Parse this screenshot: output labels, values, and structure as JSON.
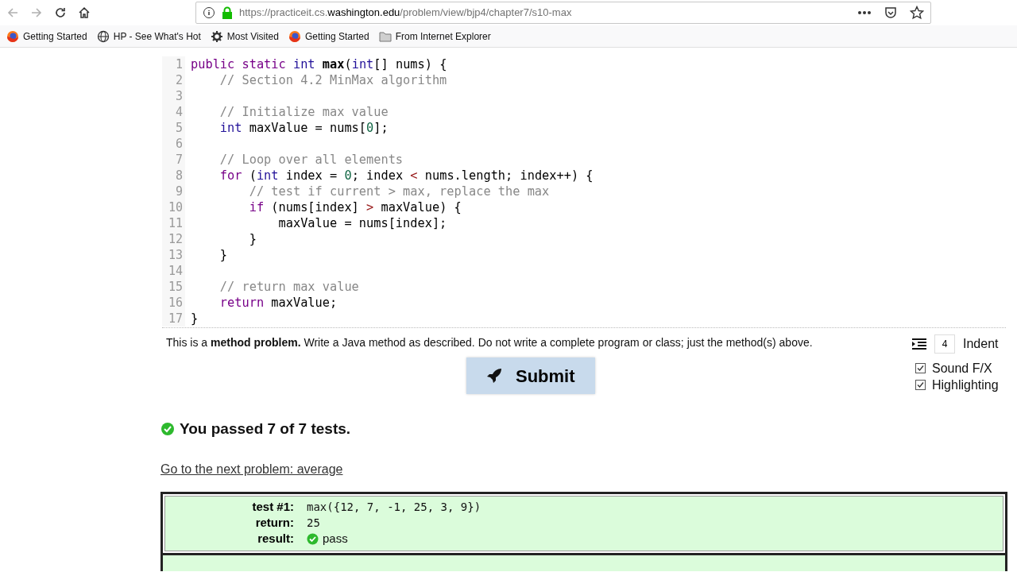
{
  "browser": {
    "url_host_prefix": "https://practiceit.cs.",
    "url_host": "washington.edu",
    "url_path": "/problem/view/bjp4/chapter7/s10-max",
    "bookmarks": [
      {
        "kind": "firefox",
        "label": "Getting Started"
      },
      {
        "kind": "globe",
        "label": "HP - See What's Hot"
      },
      {
        "kind": "gear",
        "label": "Most Visited"
      },
      {
        "kind": "firefox",
        "label": "Getting Started"
      },
      {
        "kind": "folder",
        "label": "From Internet Explorer"
      }
    ]
  },
  "editor": {
    "lines": [
      {
        "number": "1",
        "tokens": [
          {
            "kind": "keyword",
            "text": "public static"
          },
          {
            "kind": "type",
            "text": "int"
          },
          {
            "kind": "name",
            "text": "max"
          },
          {
            "kind": "plain",
            "text": "("
          },
          {
            "kind": "type",
            "text": "int"
          },
          {
            "kind": "plain",
            "text": "[] nums) {"
          }
        ]
      },
      {
        "number": "2",
        "tokens": [
          {
            "kind": "comment",
            "text": "    // Section 4.2 MinMax algorithm"
          }
        ]
      },
      {
        "number": "3"
      },
      {
        "number": "4",
        "tokens": [
          {
            "kind": "comment",
            "text": "    // Initialize max value"
          }
        ]
      },
      {
        "number": "5",
        "tokens": [
          {
            "kind": "type",
            "text": "    int"
          },
          {
            "kind": "plain",
            "text": " maxValue = nums["
          },
          {
            "kind": "number",
            "text": "0"
          },
          {
            "kind": "plain",
            "text": "];"
          }
        ]
      },
      {
        "number": "6"
      },
      {
        "number": "7",
        "tokens": [
          {
            "kind": "comment",
            "text": "    // Loop over all elements"
          }
        ]
      },
      {
        "number": "8",
        "tokens": [
          {
            "kind": "keyword",
            "text": "    for"
          },
          {
            "kind": "plain",
            "text": " ("
          },
          {
            "kind": "type",
            "text": "int"
          },
          {
            "kind": "plain",
            "text": " index = "
          },
          {
            "kind": "number",
            "text": "0"
          },
          {
            "kind": "plain",
            "text": "; index "
          },
          {
            "kind": "operator",
            "text": "<"
          },
          {
            "kind": "plain",
            "text": " nums.length; index++) {"
          }
        ]
      },
      {
        "number": "9",
        "tokens": [
          {
            "kind": "comment",
            "text": "        // test if current > max, replace the max"
          }
        ]
      },
      {
        "number": "10",
        "tokens": [
          {
            "kind": "keyword",
            "text": "        if"
          },
          {
            "kind": "plain",
            "text": " (nums[index] "
          },
          {
            "kind": "operator",
            "text": ">"
          },
          {
            "kind": "plain",
            "text": " maxValue) {"
          }
        ]
      },
      {
        "number": "11",
        "tokens": [
          {
            "kind": "plain",
            "text": "            maxValue = nums[index];"
          }
        ]
      },
      {
        "number": "12",
        "tokens": [
          {
            "kind": "plain",
            "text": "        }"
          }
        ]
      },
      {
        "number": "13",
        "tokens": [
          {
            "kind": "plain",
            "text": "    }"
          }
        ]
      },
      {
        "number": "14"
      },
      {
        "number": "15",
        "tokens": [
          {
            "kind": "comment",
            "text": "    // return max value"
          }
        ]
      },
      {
        "number": "16",
        "tokens": [
          {
            "kind": "keyword",
            "text": "    return"
          },
          {
            "kind": "plain",
            "text": " maxValue;"
          }
        ]
      },
      {
        "number": "17",
        "tokens": [
          {
            "kind": "plain",
            "text": "}"
          }
        ]
      }
    ]
  },
  "instructions": "This is a **method problem.** Write a Java method as described. Do not write a complete program or class; just the method(s) above.",
  "indent": {
    "value": "4",
    "label": "Indent"
  },
  "options": [
    {
      "label": "Sound F/X",
      "checked": true
    },
    {
      "label": "Highlighting",
      "checked": true
    }
  ],
  "submit_button": "Submit",
  "result_message": "You passed 7 of 7 tests.",
  "next_link": "Go to the next problem: average",
  "tests": [
    {
      "passed": true,
      "rows": [
        {
          "label": "test #1:",
          "value": "max({12, 7, -1, 25, 3, 9})",
          "kind": "code"
        },
        {
          "label": "return:",
          "value": "25",
          "kind": "code"
        },
        {
          "label": "result:",
          "value": "pass",
          "kind": "result"
        }
      ]
    }
  ]
}
